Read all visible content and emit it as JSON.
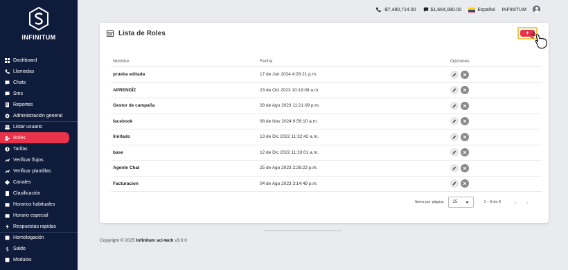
{
  "brand": {
    "name": "INFINITUM"
  },
  "sidebar": {
    "items": [
      {
        "label": "Dashboard",
        "icon": "dashboard-icon"
      },
      {
        "label": "Llamadas",
        "icon": "phone-icon"
      },
      {
        "label": "Chats",
        "icon": "chat-icon"
      },
      {
        "label": "Sms",
        "icon": "sms-icon"
      },
      {
        "label": "Reportes",
        "icon": "report-icon"
      },
      {
        "label": "Administración general",
        "icon": "gear-icon"
      },
      {
        "label": "Listar usuario",
        "icon": "users-icon"
      },
      {
        "label": "Roles",
        "icon": "roles-icon"
      },
      {
        "label": "Tarifas",
        "icon": "rates-icon"
      },
      {
        "label": "Verificar flujos",
        "icon": "flows-icon"
      },
      {
        "label": "Verificar plantillas",
        "icon": "templates-icon"
      },
      {
        "label": "Canales",
        "icon": "channels-icon"
      },
      {
        "label": "Clasificación",
        "icon": "classification-icon"
      },
      {
        "label": "Horarios habituales",
        "icon": "calendar-icon"
      },
      {
        "label": "Horario especial",
        "icon": "calendar-special-icon"
      },
      {
        "label": "Respuestas rapidas",
        "icon": "bolt-icon"
      },
      {
        "label": "Homologación",
        "icon": "homologation-icon"
      },
      {
        "label": "Saldo",
        "icon": "dollar-icon"
      },
      {
        "label": "Modulos",
        "icon": "modules-icon"
      }
    ],
    "active_label": "Roles"
  },
  "topbar": {
    "balance_phone": "-$7,480,714.00",
    "balance_chat": "$1,664,080.00",
    "language": "Español",
    "account": "INFINITUM"
  },
  "card": {
    "title": "Lista de Roles",
    "add_label": "+",
    "columns": [
      "Nombre",
      "Fecha",
      "Opciones"
    ],
    "rows": [
      {
        "name": "prueba editada",
        "date": "17 de Jun 2024 4:28:21 p.m."
      },
      {
        "name": "APRENDÍZ",
        "date": "23 de Oct 2023 10:19:08 a.m."
      },
      {
        "name": "Gestor de campaña",
        "date": "28 de Ago 2023 11:21:09 p.m."
      },
      {
        "name": "facebook",
        "date": "08 de Nov 2024 9:59:10 a.m."
      },
      {
        "name": "limitado",
        "date": "13 de Dic 2022 11:32:42 a.m."
      },
      {
        "name": "base",
        "date": "12 de Dic 2022 11:33:01 a.m."
      },
      {
        "name": "Agente Chat",
        "date": "25 de Ago 2023 2:26:23 p.m."
      },
      {
        "name": "Facturacion",
        "date": "04 de Ago 2023 3:14:49 p.m."
      }
    ]
  },
  "pagination": {
    "items_per_page_label": "Items por página:",
    "items_per_page_value": "25",
    "range": "1 – 8 de 8",
    "prev": "‹",
    "next": "›"
  },
  "footer": {
    "prefix": "Copyright © 2025 ",
    "company": "Infinitum sci-tech",
    "version": " v3.0.0"
  },
  "colors": {
    "sidebar": "#0e1b3a",
    "accent": "#e8334a",
    "highlight": "#f2c94c"
  }
}
